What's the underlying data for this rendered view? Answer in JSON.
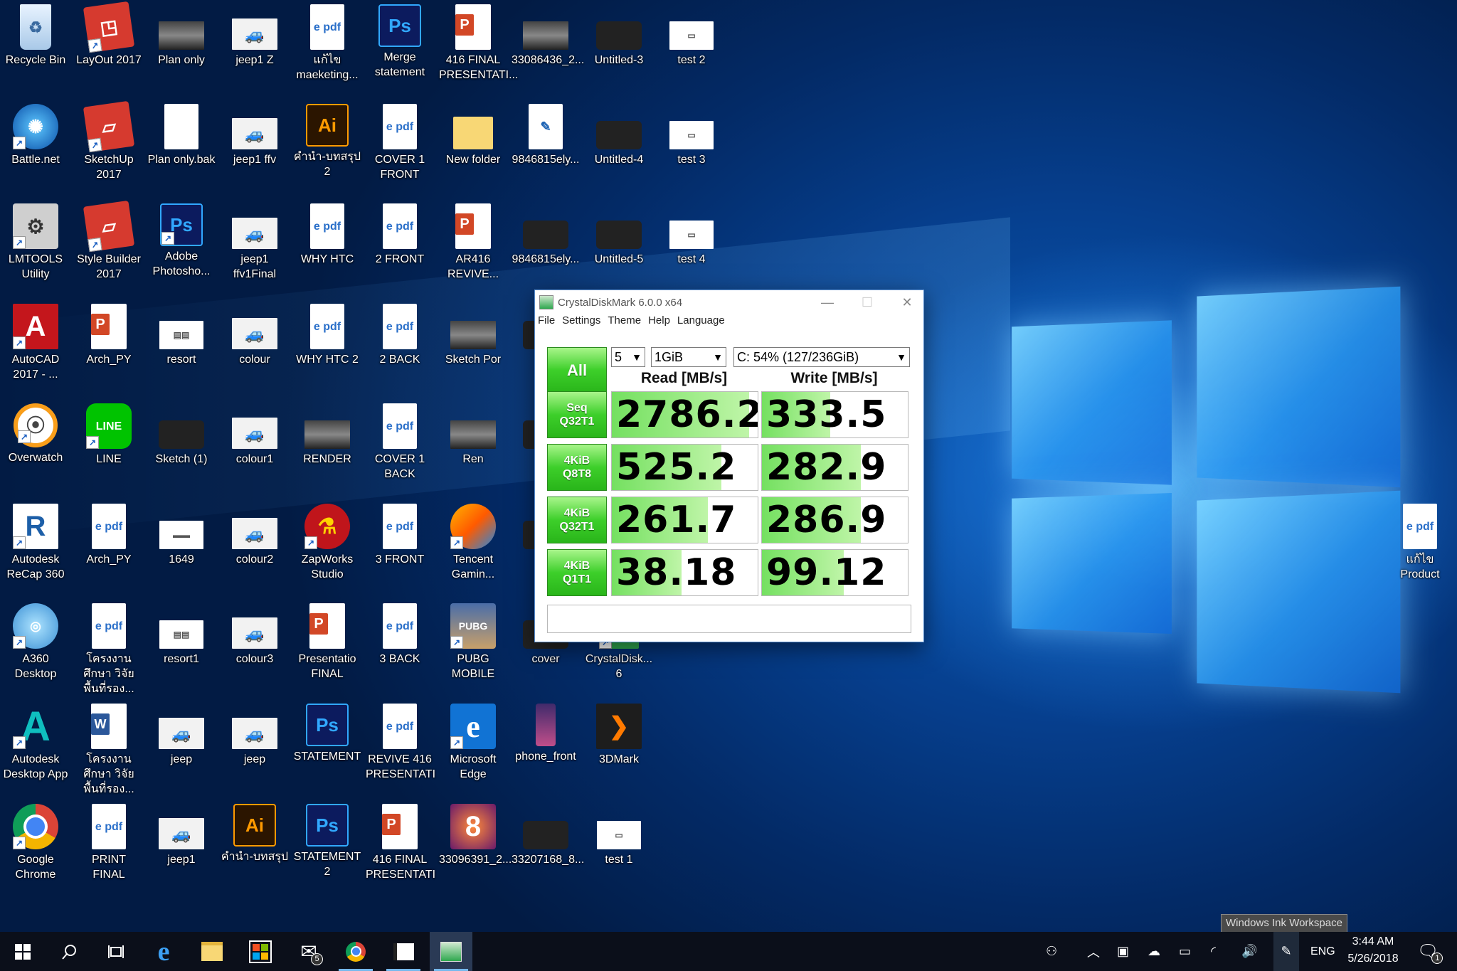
{
  "desktop_icons": [
    {
      "label": "Recycle Bin"
    },
    {
      "label": "LayOut 2017"
    },
    {
      "label": "Plan only"
    },
    {
      "label": "jeep1 Z"
    },
    {
      "label": "แก้ไข maeketing..."
    },
    {
      "label": "Merge statement"
    },
    {
      "label": "416 FINAL PRESENTATI..."
    },
    {
      "label": "33086436_2..."
    },
    {
      "label": "Untitled-3"
    },
    {
      "label": "test 2"
    },
    {
      "label": "Battle.net"
    },
    {
      "label": "SketchUp 2017"
    },
    {
      "label": "Plan only.bak"
    },
    {
      "label": "jeep1 ffv"
    },
    {
      "label": "คำนำ-บทสรุป 2"
    },
    {
      "label": "COVER 1 FRONT"
    },
    {
      "label": "New folder"
    },
    {
      "label": "9846815ely..."
    },
    {
      "label": "Untitled-4"
    },
    {
      "label": "test 3"
    },
    {
      "label": "LMTOOLS Utility"
    },
    {
      "label": "Style Builder 2017"
    },
    {
      "label": "Adobe Photosho..."
    },
    {
      "label": "jeep1 ffv1Final"
    },
    {
      "label": "WHY HTC"
    },
    {
      "label": "2 FRONT"
    },
    {
      "label": "AR416 REVIVE..."
    },
    {
      "label": "9846815ely..."
    },
    {
      "label": "Untitled-5"
    },
    {
      "label": "test 4"
    },
    {
      "label": "AutoCAD 2017 - ..."
    },
    {
      "label": "Arch_PY"
    },
    {
      "label": "resort"
    },
    {
      "label": "colour"
    },
    {
      "label": "WHY HTC 2"
    },
    {
      "label": "2 BACK"
    },
    {
      "label": "Sketch Por"
    },
    {
      "label": "984"
    },
    {
      "label": "Overwatch"
    },
    {
      "label": "LINE"
    },
    {
      "label": "Sketch (1)"
    },
    {
      "label": "colour1"
    },
    {
      "label": "RENDER"
    },
    {
      "label": "COVER 1 BACK"
    },
    {
      "label": "Ren"
    },
    {
      "label": "984"
    },
    {
      "label": "Autodesk ReCap 360"
    },
    {
      "label": "Arch_PY"
    },
    {
      "label": "1649"
    },
    {
      "label": "colour2"
    },
    {
      "label": "ZapWorks Studio"
    },
    {
      "label": "3 FRONT"
    },
    {
      "label": "Tencent Gamin..."
    },
    {
      "label": "671"
    },
    {
      "label": "A360 Desktop"
    },
    {
      "label": "โครงงานศึกษา วิจัยพื้นที่รอง..."
    },
    {
      "label": "resort1"
    },
    {
      "label": "colour3"
    },
    {
      "label": "Presentatio FINAL"
    },
    {
      "label": "3 BACK"
    },
    {
      "label": "PUBG MOBILE"
    },
    {
      "label": "cover"
    },
    {
      "label": "CrystalDisk... 6"
    },
    {
      "label": "Autodesk Desktop App"
    },
    {
      "label": "โครงงานศึกษา วิจัยพื้นที่รอง..."
    },
    {
      "label": "jeep"
    },
    {
      "label": "jeep"
    },
    {
      "label": "STATEMENT"
    },
    {
      "label": "REVIVE 416 PRESENTATI"
    },
    {
      "label": "Microsoft Edge"
    },
    {
      "label": "phone_front"
    },
    {
      "label": "3DMark"
    },
    {
      "label": "Google Chrome"
    },
    {
      "label": "PRINT FINAL"
    },
    {
      "label": "jeep1"
    },
    {
      "label": "คำนำ-บทสรุป"
    },
    {
      "label": "STATEMENT 2"
    },
    {
      "label": "416 FINAL PRESENTATI"
    },
    {
      "label": "33096391_2..."
    },
    {
      "label": "33207168_8..."
    },
    {
      "label": "test 1"
    },
    {
      "label": "แก้ไข Product"
    }
  ],
  "cdm": {
    "title": "CrystalDiskMark 6.0.0 x64",
    "menu": [
      "File",
      "Settings",
      "Theme",
      "Help",
      "Language"
    ],
    "all_label": "All",
    "count": "5",
    "size": "1GiB",
    "drive": "C: 54% (127/236GiB)",
    "read_header": "Read [MB/s]",
    "write_header": "Write [MB/s]",
    "tests": [
      {
        "line1": "Seq",
        "line2": "Q32T1",
        "read": "2786.2",
        "write": "333.5",
        "read_frac": 0.94,
        "write_frac": 0.47
      },
      {
        "line1": "4KiB",
        "line2": "Q8T8",
        "read": "525.2",
        "write": "282.9",
        "read_frac": 0.75,
        "write_frac": 0.68
      },
      {
        "line1": "4KiB",
        "line2": "Q32T1",
        "read": "261.7",
        "write": "286.9",
        "read_frac": 0.66,
        "write_frac": 0.68
      },
      {
        "line1": "4KiB",
        "line2": "Q1T1",
        "read": "38.18",
        "write": "99.12",
        "read_frac": 0.48,
        "write_frac": 0.56
      }
    ]
  },
  "tooltip": "Windows Ink Workspace",
  "taskbar": {
    "mail_badge": "5",
    "lang": "ENG",
    "time": "3:44 AM",
    "date": "5/26/2018",
    "notif_count": "1"
  },
  "colors": {
    "bar_green": "#3dcf2a",
    "fill_green": "#74e060",
    "taskbar": "#0b0f1a"
  }
}
